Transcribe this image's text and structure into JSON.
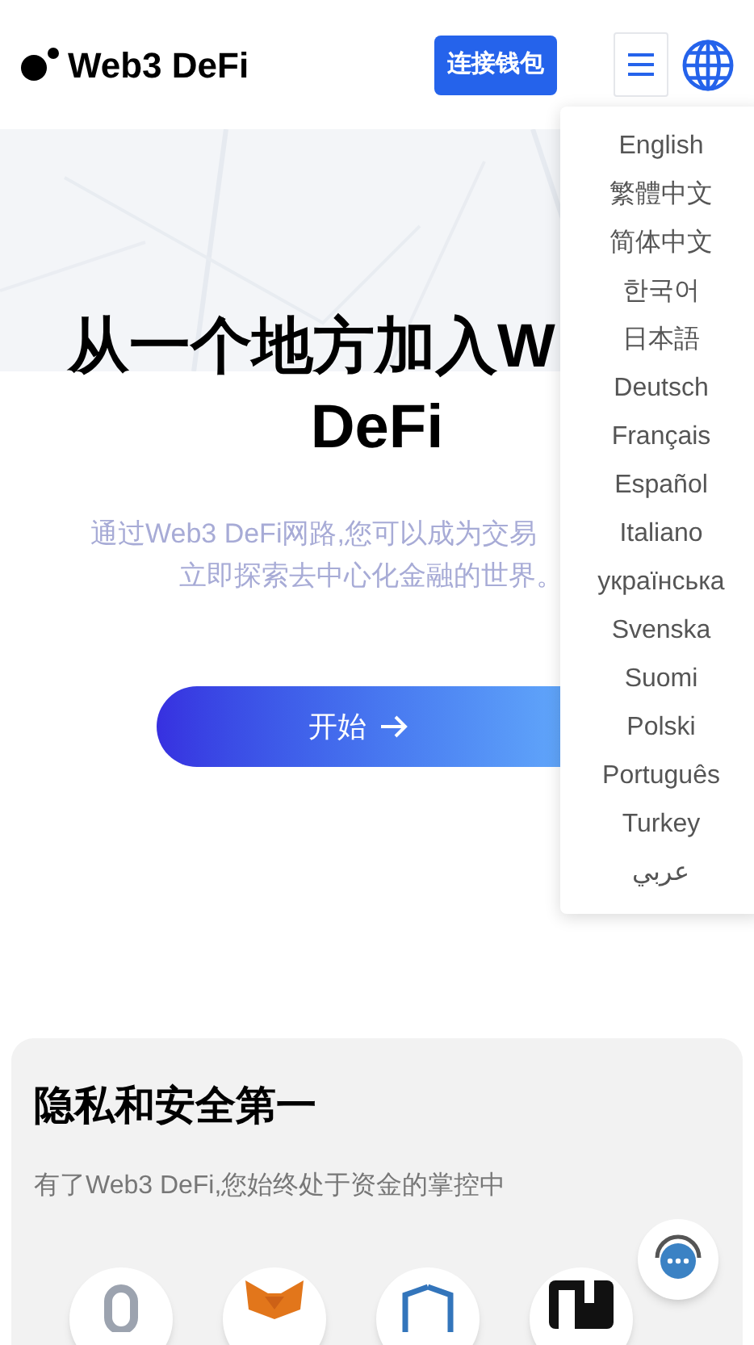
{
  "header": {
    "logo_text": "Web3 DeFi",
    "connect_button": "连接钱包"
  },
  "hero": {
    "title_lines": [
      "从一个地方加入W",
      "DeFi"
    ],
    "subtitle_lines": [
      "通过Web3 DeFi网路,您可以成为交易",
      "立即探索去中心化金融的世界。"
    ],
    "start_button": "开始"
  },
  "language_menu": {
    "items": [
      {
        "label": "English"
      },
      {
        "label": "繁體中文"
      },
      {
        "label": "简体中文"
      },
      {
        "label": "한국어"
      },
      {
        "label": "日本語"
      },
      {
        "label": "Deutsch"
      },
      {
        "label": "Français"
      },
      {
        "label": "Español"
      },
      {
        "label": "Italiano"
      },
      {
        "label": "українська"
      },
      {
        "label": "Svenska"
      },
      {
        "label": "Suomi"
      },
      {
        "label": "Polski"
      },
      {
        "label": "Português"
      },
      {
        "label": "Turkey"
      },
      {
        "label": "عربي"
      }
    ]
  },
  "feature_card": {
    "title": "隐私和安全第一",
    "text": "有了Web3 DeFi,您始终处于资金的掌控中"
  }
}
